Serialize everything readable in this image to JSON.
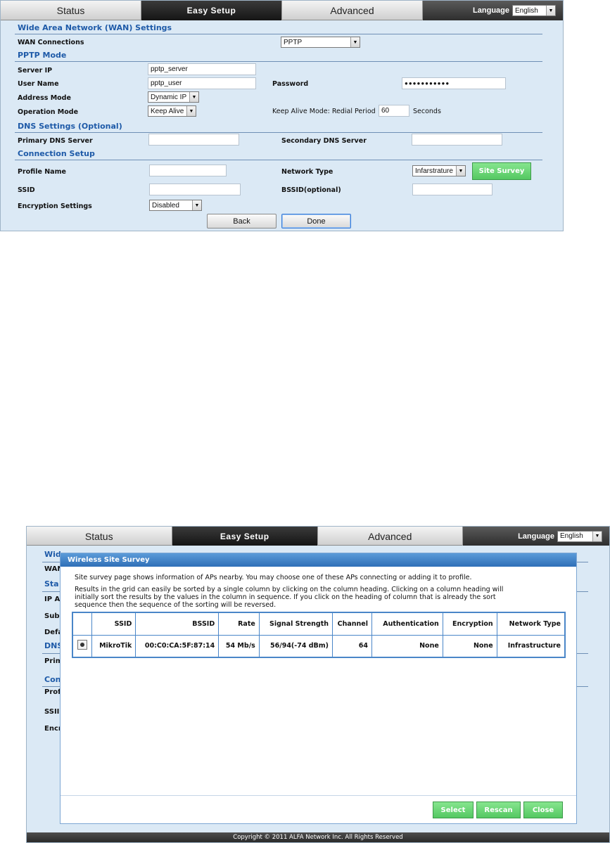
{
  "nav": {
    "tabs": [
      "Status",
      "Easy Setup",
      "Advanced"
    ],
    "language_label": "Language",
    "language_value": "English"
  },
  "wan": {
    "section_title": "Wide Area Network (WAN) Settings",
    "connections_label": "WAN Connections",
    "connections_value": "PPTP"
  },
  "pptp": {
    "section_title": "PPTP Mode",
    "server_ip_label": "Server IP",
    "server_ip_value": "pptp_server",
    "username_label": "User Name",
    "username_value": "pptp_user",
    "password_label": "Password",
    "password_value": "●●●●●●●●●●●",
    "address_mode_label": "Address Mode",
    "address_mode_value": "Dynamic IP",
    "operation_mode_label": "Operation Mode",
    "operation_mode_value": "Keep Alive",
    "redial_label": "Keep Alive Mode: Redial Period",
    "redial_value": "60",
    "redial_unit": "Seconds"
  },
  "dns": {
    "section_title": "DNS Settings (Optional)",
    "primary_label": "Primary DNS Server",
    "primary_value": "",
    "secondary_label": "Secondary DNS Server",
    "secondary_value": ""
  },
  "conn": {
    "section_title": "Connection Setup",
    "profile_label": "Profile Name",
    "profile_value": "",
    "network_type_label": "Network Type",
    "network_type_value": "Infarstrature",
    "site_survey_button": "Site Survey",
    "ssid_label": "SSID",
    "ssid_value": "",
    "bssid_label": "BSSID(optional)",
    "bssid_value": "",
    "encryption_label": "Encryption Settings",
    "encryption_value": "Disabled"
  },
  "actions": {
    "back": "Back",
    "done": "Done"
  },
  "background_fragments": {
    "wide": "Wid",
    "wan": "WAN",
    "sta": "Sta",
    "ip": "IP A",
    "sub": "Sub",
    "def": "Defa",
    "dns": "DNS",
    "prim": "Prim",
    "con": "Con",
    "prof": "Prof",
    "ssid": "SSII",
    "encr": "Encr"
  },
  "survey": {
    "title": "Wireless Site Survey",
    "intro": "Site survey page shows information of APs nearby. You may choose one of these APs connecting or adding it to profile.",
    "sort_help_1": "Results in the grid can easily be sorted by a single column by clicking on the column heading. Clicking on a column heading will",
    "sort_help_2": "initially sort the results by the values in the column in sequence. If you click on the heading of column that is already the sort",
    "sort_help_3": "sequence then the sequence of the sorting will be reversed.",
    "columns": [
      "SSID",
      "BSSID",
      "Rate",
      "Signal Strength",
      "Channel",
      "Authentication",
      "Encryption",
      "Network Type"
    ],
    "rows": [
      {
        "ssid": "MikroTik",
        "bssid": "00:C0:CA:5F:87:14",
        "rate": "54 Mb/s",
        "signal": "56/94(-74 dBm)",
        "channel": "64",
        "auth": "None",
        "enc": "None",
        "net_type": "Infrastructure"
      }
    ],
    "buttons": {
      "select": "Select",
      "rescan": "Rescan",
      "close": "Close"
    }
  },
  "copyright": "Copyright © 2011 ALFA Network Inc. All Rights Reserved"
}
